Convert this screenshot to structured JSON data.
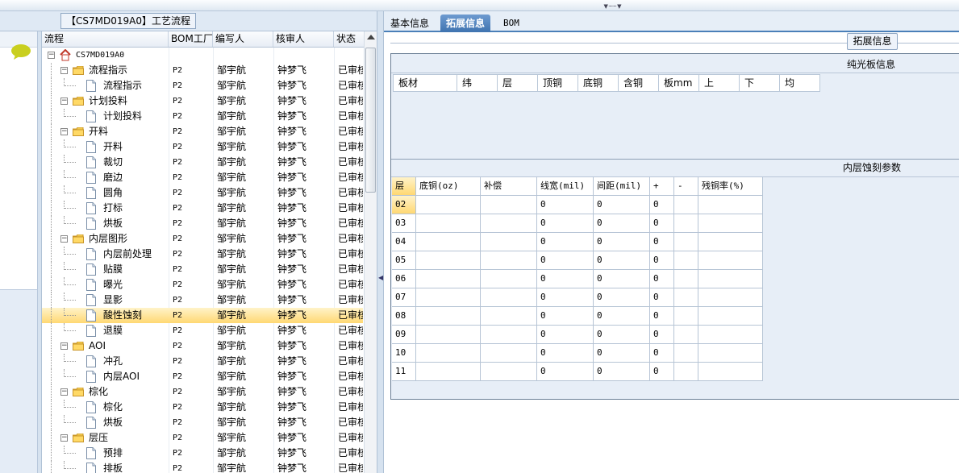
{
  "window": {
    "title_panel": "【CS7MD019A0】工艺流程"
  },
  "grid": {
    "columns": [
      "流程",
      "BOM工厂",
      "编写人",
      "核审人",
      "状态"
    ],
    "rows": [
      {
        "name": "CS7MD019A0",
        "level": 0,
        "type": "root",
        "bom": "",
        "author": "",
        "reviewer": "",
        "status": ""
      },
      {
        "name": "流程指示",
        "level": 1,
        "type": "folder",
        "bom": "P2",
        "author": "邹宇航",
        "reviewer": "钟梦飞",
        "status": "已审核"
      },
      {
        "name": "流程指示",
        "level": 2,
        "type": "doc",
        "bom": "P2",
        "author": "邹宇航",
        "reviewer": "钟梦飞",
        "status": "已审核"
      },
      {
        "name": "计划投料",
        "level": 1,
        "type": "folder",
        "bom": "P2",
        "author": "邹宇航",
        "reviewer": "钟梦飞",
        "status": "已审核"
      },
      {
        "name": "计划投料",
        "level": 2,
        "type": "doc",
        "bom": "P2",
        "author": "邹宇航",
        "reviewer": "钟梦飞",
        "status": "已审核"
      },
      {
        "name": "开料",
        "level": 1,
        "type": "folder",
        "bom": "P2",
        "author": "邹宇航",
        "reviewer": "钟梦飞",
        "status": "已审核"
      },
      {
        "name": "开料",
        "level": 2,
        "type": "doc",
        "bom": "P2",
        "author": "邹宇航",
        "reviewer": "钟梦飞",
        "status": "已审核"
      },
      {
        "name": "裁切",
        "level": 2,
        "type": "doc",
        "bom": "P2",
        "author": "邹宇航",
        "reviewer": "钟梦飞",
        "status": "已审核"
      },
      {
        "name": "磨边",
        "level": 2,
        "type": "doc",
        "bom": "P2",
        "author": "邹宇航",
        "reviewer": "钟梦飞",
        "status": "已审核"
      },
      {
        "name": "圆角",
        "level": 2,
        "type": "doc",
        "bom": "P2",
        "author": "邹宇航",
        "reviewer": "钟梦飞",
        "status": "已审核"
      },
      {
        "name": "打标",
        "level": 2,
        "type": "doc",
        "bom": "P2",
        "author": "邹宇航",
        "reviewer": "钟梦飞",
        "status": "已审核"
      },
      {
        "name": "烘板",
        "level": 2,
        "type": "doc",
        "bom": "P2",
        "author": "邹宇航",
        "reviewer": "钟梦飞",
        "status": "已审核"
      },
      {
        "name": "内层图形",
        "level": 1,
        "type": "folder",
        "bom": "P2",
        "author": "邹宇航",
        "reviewer": "钟梦飞",
        "status": "已审核"
      },
      {
        "name": "内层前处理",
        "level": 2,
        "type": "doc",
        "bom": "P2",
        "author": "邹宇航",
        "reviewer": "钟梦飞",
        "status": "已审核"
      },
      {
        "name": "贴膜",
        "level": 2,
        "type": "doc",
        "bom": "P2",
        "author": "邹宇航",
        "reviewer": "钟梦飞",
        "status": "已审核"
      },
      {
        "name": "曝光",
        "level": 2,
        "type": "doc",
        "bom": "P2",
        "author": "邹宇航",
        "reviewer": "钟梦飞",
        "status": "已审核"
      },
      {
        "name": "显影",
        "level": 2,
        "type": "doc",
        "bom": "P2",
        "author": "邹宇航",
        "reviewer": "钟梦飞",
        "status": "已审核"
      },
      {
        "name": "酸性蚀刻",
        "level": 2,
        "type": "doc",
        "bom": "P2",
        "author": "邹宇航",
        "reviewer": "钟梦飞",
        "status": "已审核",
        "selected": true
      },
      {
        "name": "退膜",
        "level": 2,
        "type": "doc",
        "bom": "P2",
        "author": "邹宇航",
        "reviewer": "钟梦飞",
        "status": "已审核"
      },
      {
        "name": "AOI",
        "level": 1,
        "type": "folder",
        "bom": "P2",
        "author": "邹宇航",
        "reviewer": "钟梦飞",
        "status": "已审核"
      },
      {
        "name": "冲孔",
        "level": 2,
        "type": "doc",
        "bom": "P2",
        "author": "邹宇航",
        "reviewer": "钟梦飞",
        "status": "已审核"
      },
      {
        "name": "内层AOI",
        "level": 2,
        "type": "doc",
        "bom": "P2",
        "author": "邹宇航",
        "reviewer": "钟梦飞",
        "status": "已审核"
      },
      {
        "name": "棕化",
        "level": 1,
        "type": "folder",
        "bom": "P2",
        "author": "邹宇航",
        "reviewer": "钟梦飞",
        "status": "已审核"
      },
      {
        "name": "棕化",
        "level": 2,
        "type": "doc",
        "bom": "P2",
        "author": "邹宇航",
        "reviewer": "钟梦飞",
        "status": "已审核"
      },
      {
        "name": "烘板",
        "level": 2,
        "type": "doc",
        "bom": "P2",
        "author": "邹宇航",
        "reviewer": "钟梦飞",
        "status": "已审核"
      },
      {
        "name": "层压",
        "level": 1,
        "type": "folder",
        "bom": "P2",
        "author": "邹宇航",
        "reviewer": "钟梦飞",
        "status": "已审核"
      },
      {
        "name": "预排",
        "level": 2,
        "type": "doc",
        "bom": "P2",
        "author": "邹宇航",
        "reviewer": "钟梦飞",
        "status": "已审核"
      },
      {
        "name": "排板",
        "level": 2,
        "type": "doc",
        "bom": "P2",
        "author": "邹宇航",
        "reviewer": "钟梦飞",
        "status": "已审核"
      }
    ]
  },
  "tabs": {
    "basic": "基本信息",
    "extended": "拓展信息",
    "bom": "BOM"
  },
  "ext_button": "拓展信息",
  "section1": {
    "title": "纯光板信息",
    "columns": [
      "板材",
      "纬",
      "层",
      "顶铜",
      "底铜",
      "含铜",
      "板mm",
      "上",
      "下",
      "均"
    ]
  },
  "section2": {
    "title": "内层蚀刻参数",
    "columns": [
      "层",
      "底铜(oz)",
      "补偿",
      "线宽(mil)",
      "间距(mil)",
      "+",
      "-",
      "残铜率(%)"
    ],
    "rows": [
      {
        "layer": "02",
        "base": "",
        "comp": "",
        "width": "0",
        "space": "0",
        "plus": "0",
        "minus": "",
        "rate": ""
      },
      {
        "layer": "03",
        "base": "",
        "comp": "",
        "width": "0",
        "space": "0",
        "plus": "0",
        "minus": "",
        "rate": ""
      },
      {
        "layer": "04",
        "base": "",
        "comp": "",
        "width": "0",
        "space": "0",
        "plus": "0",
        "minus": "",
        "rate": ""
      },
      {
        "layer": "05",
        "base": "",
        "comp": "",
        "width": "0",
        "space": "0",
        "plus": "0",
        "minus": "",
        "rate": ""
      },
      {
        "layer": "06",
        "base": "",
        "comp": "",
        "width": "0",
        "space": "0",
        "plus": "0",
        "minus": "",
        "rate": ""
      },
      {
        "layer": "07",
        "base": "",
        "comp": "",
        "width": "0",
        "space": "0",
        "plus": "0",
        "minus": "",
        "rate": ""
      },
      {
        "layer": "08",
        "base": "",
        "comp": "",
        "width": "0",
        "space": "0",
        "plus": "0",
        "minus": "",
        "rate": ""
      },
      {
        "layer": "09",
        "base": "",
        "comp": "",
        "width": "0",
        "space": "0",
        "plus": "0",
        "minus": "",
        "rate": ""
      },
      {
        "layer": "10",
        "base": "",
        "comp": "",
        "width": "0",
        "space": "0",
        "plus": "0",
        "minus": "",
        "rate": ""
      },
      {
        "layer": "11",
        "base": "",
        "comp": "",
        "width": "0",
        "space": "0",
        "plus": "0",
        "minus": "",
        "rate": ""
      }
    ]
  },
  "icons": {
    "chat": "speech-bubble-icon",
    "home": "home-icon",
    "folder": "folder-icon",
    "doc": "document-icon"
  },
  "colors": {
    "accent": "#3f73b0",
    "selection": "#ffd873",
    "panel": "#e7eef7"
  }
}
